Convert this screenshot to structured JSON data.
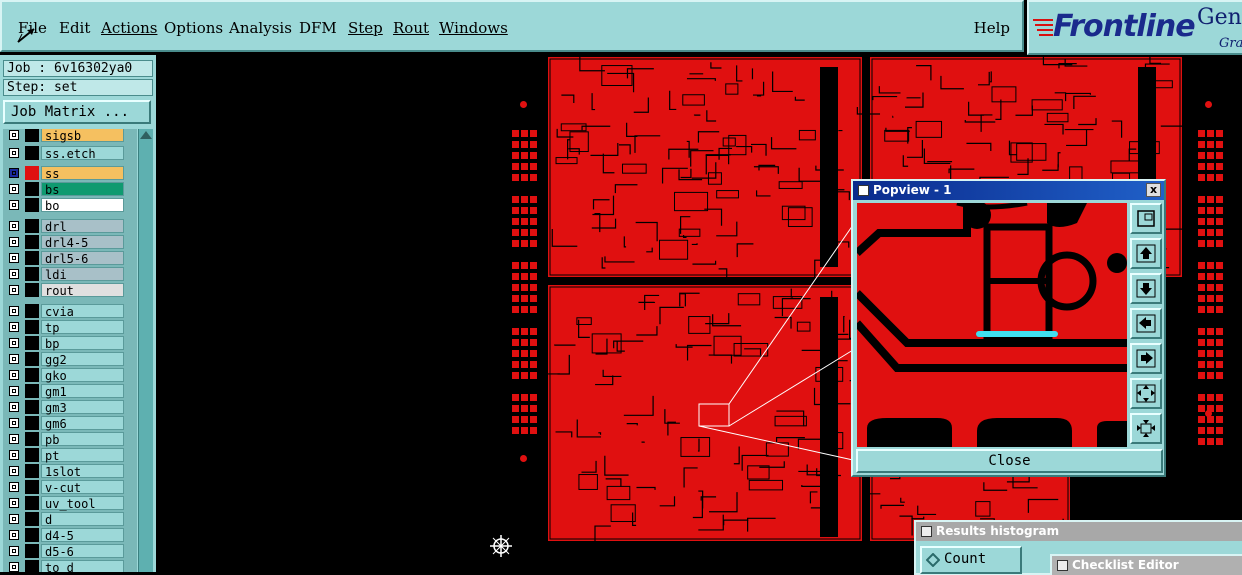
{
  "menubar": {
    "items": [
      {
        "label": "File"
      },
      {
        "label": "Edit"
      },
      {
        "label": "Actions"
      },
      {
        "label": "Options"
      },
      {
        "label": "Analysis"
      },
      {
        "label": "DFM"
      },
      {
        "label": "Step"
      },
      {
        "label": "Rout"
      },
      {
        "label": "Windows"
      }
    ],
    "help": "Help"
  },
  "logo": {
    "brand": "Frontline",
    "product": "Gen",
    "sub": "Gra"
  },
  "job_panel": {
    "job": "Job : 6v16302ya0",
    "step": "Step: set",
    "job_matrix_button": "Job Matrix ..."
  },
  "layers": [
    {
      "name": "sigsb",
      "color": "#f5c060",
      "swatch": "#000000"
    },
    {
      "name": "ss.etch",
      "color": "#9cd8d8",
      "swatch": "#000000"
    },
    {
      "name": "ss",
      "color": "#f5c060",
      "swatch": "#e01010",
      "checked_active": true
    },
    {
      "name": "bs",
      "color": "#0f9a70",
      "swatch": "#000000"
    },
    {
      "name": "bo",
      "color": "#ffffff",
      "swatch": "#000000"
    },
    {
      "name": "drl",
      "color": "#a8c0c8",
      "swatch": "#000000"
    },
    {
      "name": "drl4-5",
      "color": "#a8c0c8",
      "swatch": "#000000"
    },
    {
      "name": "drl5-6",
      "color": "#a8c0c8",
      "swatch": "#000000"
    },
    {
      "name": "ldi",
      "color": "#a8c0c8",
      "swatch": "#000000"
    },
    {
      "name": "rout",
      "color": "#e0e0e0",
      "swatch": "#000000"
    },
    {
      "name": "cvia",
      "color": "#9cd8d8",
      "swatch": "#000000"
    },
    {
      "name": "tp",
      "color": "#9cd8d8",
      "swatch": "#000000"
    },
    {
      "name": "bp",
      "color": "#9cd8d8",
      "swatch": "#000000"
    },
    {
      "name": "gg2",
      "color": "#9cd8d8",
      "swatch": "#000000"
    },
    {
      "name": "gko",
      "color": "#9cd8d8",
      "swatch": "#000000"
    },
    {
      "name": "gm1",
      "color": "#9cd8d8",
      "swatch": "#000000"
    },
    {
      "name": "gm3",
      "color": "#9cd8d8",
      "swatch": "#000000"
    },
    {
      "name": "gm6",
      "color": "#9cd8d8",
      "swatch": "#000000"
    },
    {
      "name": "pb",
      "color": "#9cd8d8",
      "swatch": "#000000"
    },
    {
      "name": "pt",
      "color": "#9cd8d8",
      "swatch": "#000000"
    },
    {
      "name": "1slot",
      "color": "#9cd8d8",
      "swatch": "#000000"
    },
    {
      "name": "v-cut",
      "color": "#9cd8d8",
      "swatch": "#000000"
    },
    {
      "name": "uv_tool",
      "color": "#9cd8d8",
      "swatch": "#000000"
    },
    {
      "name": "d",
      "color": "#9cd8d8",
      "swatch": "#000000"
    },
    {
      "name": "d4-5",
      "color": "#9cd8d8",
      "swatch": "#000000"
    },
    {
      "name": "d5-6",
      "color": "#9cd8d8",
      "swatch": "#000000"
    },
    {
      "name": "to_d",
      "color": "#9cd8d8",
      "swatch": "#000000"
    }
  ],
  "popview": {
    "title": "Popview - 1",
    "close_x": "x",
    "close_button": "Close"
  },
  "results_histogram": {
    "title": "Results histogram",
    "count_label": "Count"
  },
  "checklist_editor": {
    "title": "Checklist Editor"
  },
  "colors": {
    "board_red": "#e01010",
    "panel_bg": "#9cd8d8",
    "highlight_cyan": "#40e0f0"
  }
}
